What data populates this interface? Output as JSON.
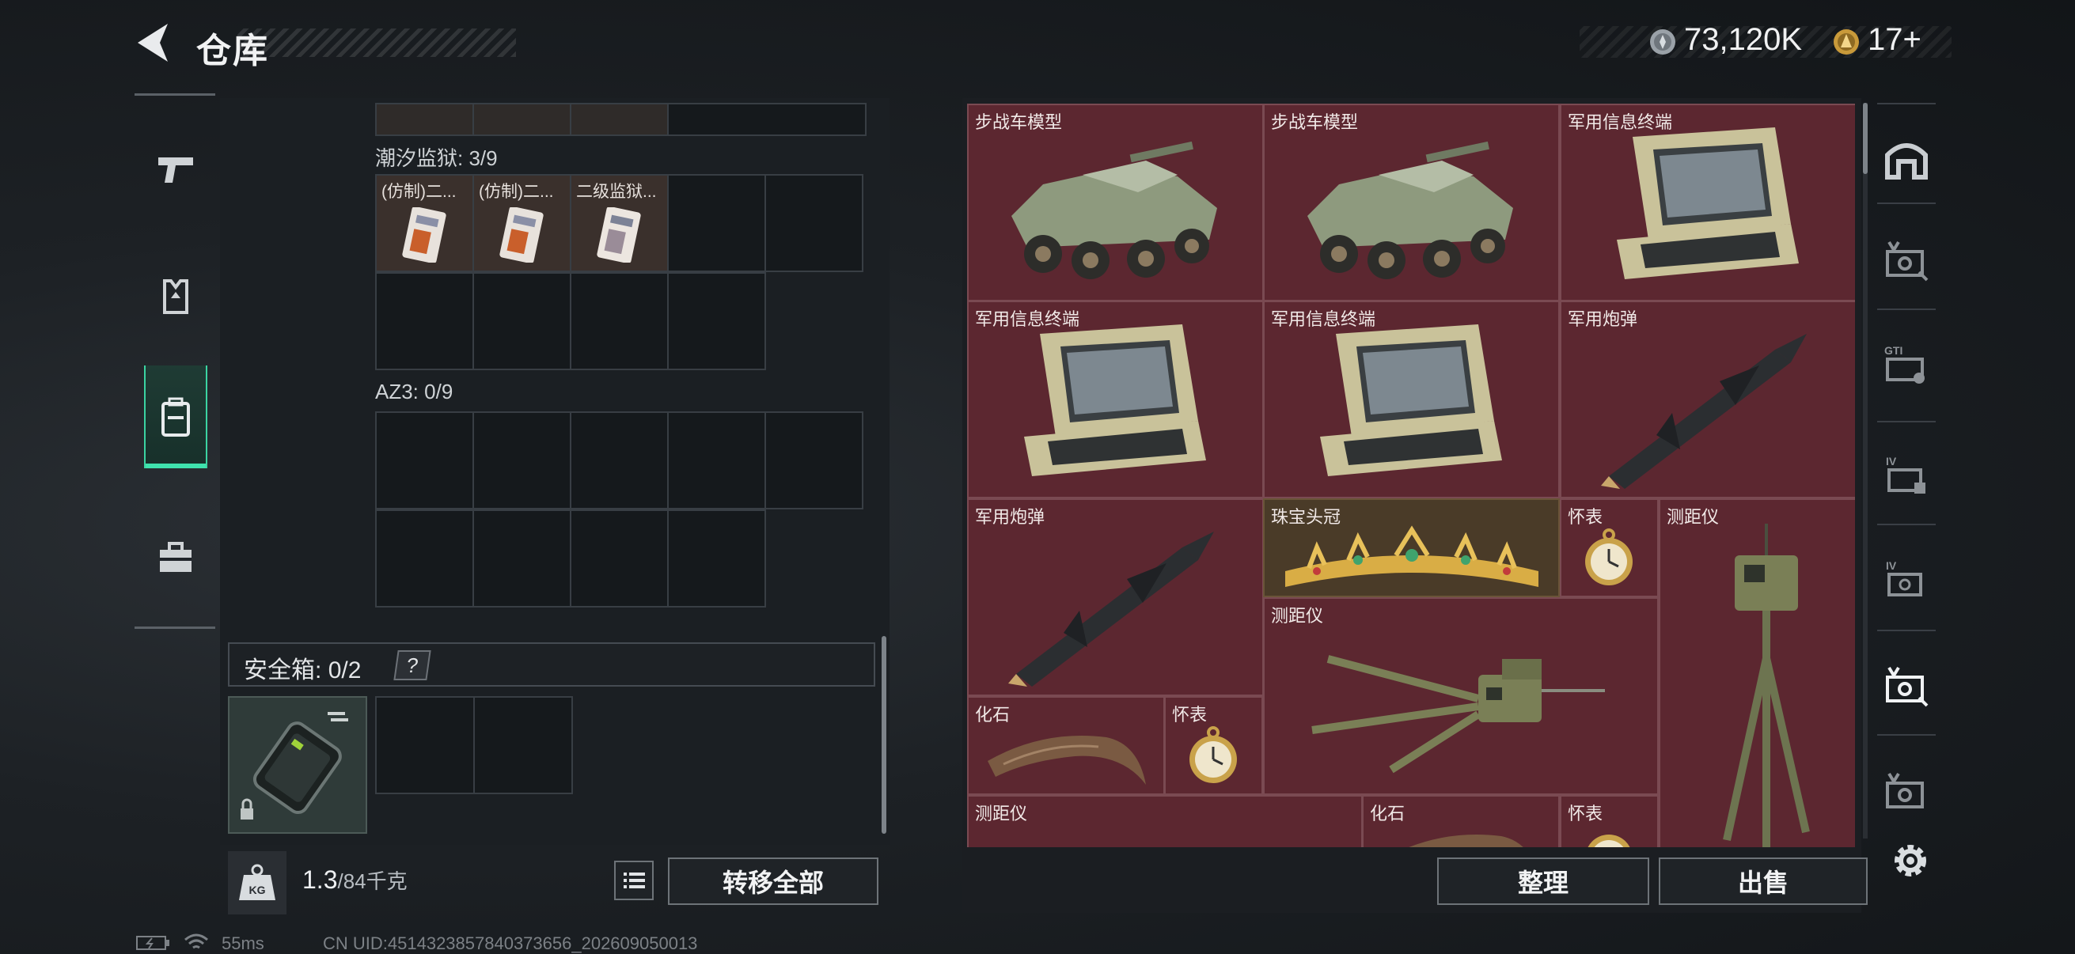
{
  "header": {
    "title": "仓库",
    "currency_a": "73,120K",
    "currency_b": "17+"
  },
  "left_rail": {
    "items": [
      {
        "name": "weapons"
      },
      {
        "name": "armor"
      },
      {
        "name": "backpack",
        "active": true
      },
      {
        "name": "toolbox"
      }
    ]
  },
  "containers": [
    {
      "label": "潮汐监狱: 3/9",
      "items": [
        "(仿制)二...",
        "(仿制)二...",
        "二级监狱..."
      ]
    },
    {
      "label": "AZ3: 0/9",
      "items": []
    }
  ],
  "safe_box": {
    "label": "安全箱:",
    "count": "0/2",
    "help": "?"
  },
  "bottom": {
    "weight_icon": "KG",
    "weight_value": "1.3",
    "weight_unit": "/84千克",
    "transfer_all": "转移全部"
  },
  "stash_items": [
    {
      "label": "步战车模型",
      "type": "vehicle"
    },
    {
      "label": "步战车模型",
      "type": "vehicle"
    },
    {
      "label": "军用信息终端",
      "type": "terminal"
    },
    {
      "label": "军用信息终端",
      "type": "terminal"
    },
    {
      "label": "军用信息终端",
      "type": "terminal"
    },
    {
      "label": "军用炮弹",
      "type": "missile"
    },
    {
      "label": "军用炮弹",
      "type": "missile"
    },
    {
      "label": "珠宝头冠",
      "type": "tiara"
    },
    {
      "label": "怀表",
      "type": "watch"
    },
    {
      "label": "测距仪",
      "type": "rangefinder-tall"
    },
    {
      "label": "测距仪",
      "type": "rangefinder"
    },
    {
      "label": "化石",
      "type": "fossil"
    },
    {
      "label": "怀表",
      "type": "watch"
    },
    {
      "label": "测距仪",
      "type": "partial"
    },
    {
      "label": "化石",
      "type": "fossil"
    },
    {
      "label": "怀表",
      "type": "watch"
    }
  ],
  "actions": {
    "tidy": "整理",
    "sell": "出售"
  },
  "right_rail": {
    "items": [
      "home-tab",
      "tab-v-1",
      "tab-gti",
      "tab-iv-1",
      "tab-iv-2",
      "tab-v-2",
      "tab-v-3"
    ]
  },
  "status_bar": {
    "ping": "55ms",
    "uid": "CN UID:4514323857840373656_202609050013"
  },
  "colors": {
    "accent": "#3fe2ad",
    "item_red": "#5c2730",
    "item_gold": "#4a3b28"
  }
}
